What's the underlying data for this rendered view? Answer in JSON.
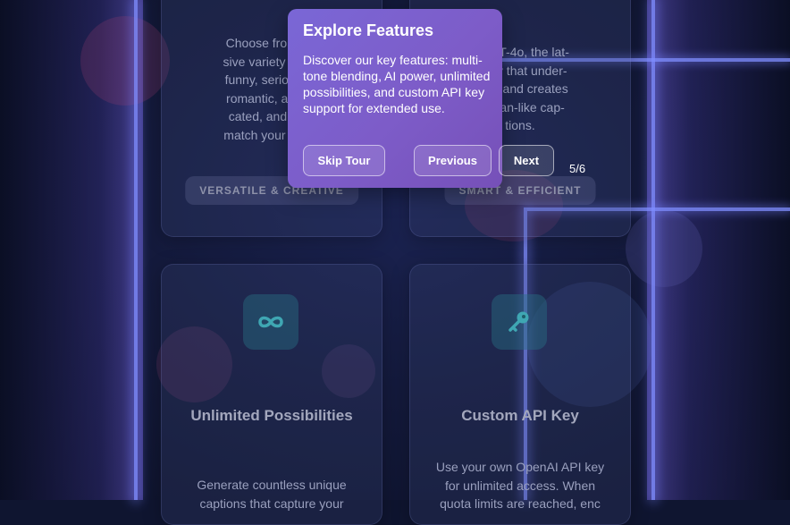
{
  "tour": {
    "title": "Explore Features",
    "body": "Discover our key features: multi-tone blending, AI power, unlimited possibilities, and custom API key support for extended use.",
    "skip_label": "Skip Tour",
    "previous_label": "Previous",
    "next_label": "Next",
    "counter": "5/6"
  },
  "cards": {
    "versatile": {
      "text_lines": [
        "Choose from a c",
        "sive variety of ton",
        "funny, serious, in",
        "romantic, artistic",
        "cated, and man",
        "match your conte"
      ],
      "badge": "VERSATILE & CREATIVE"
    },
    "smart": {
      "text_lines": [
        "y GPT-4o, the lat-",
        "ology that under-",
        "ntext and creates",
        "human-like cap-",
        "tions."
      ],
      "badge": "SMART & EFFICIENT"
    },
    "unlimited": {
      "icon": "infinity-icon",
      "title": "Unlimited Possibilities",
      "text_lines": [
        "Generate countless unique",
        "captions that capture your"
      ]
    },
    "api": {
      "icon": "key-icon",
      "title": "Custom API Key",
      "text_lines": [
        "Use your own OpenAI API key",
        "for unlimited access. When",
        "quota limits are reached, enc"
      ]
    }
  },
  "colors": {
    "background": "#0f1530",
    "accent_line": "#7f8dff",
    "tour_gradient_start": "#7a67d6",
    "tour_gradient_end": "#7650b8",
    "icon_tint": "#3fa7b3"
  }
}
